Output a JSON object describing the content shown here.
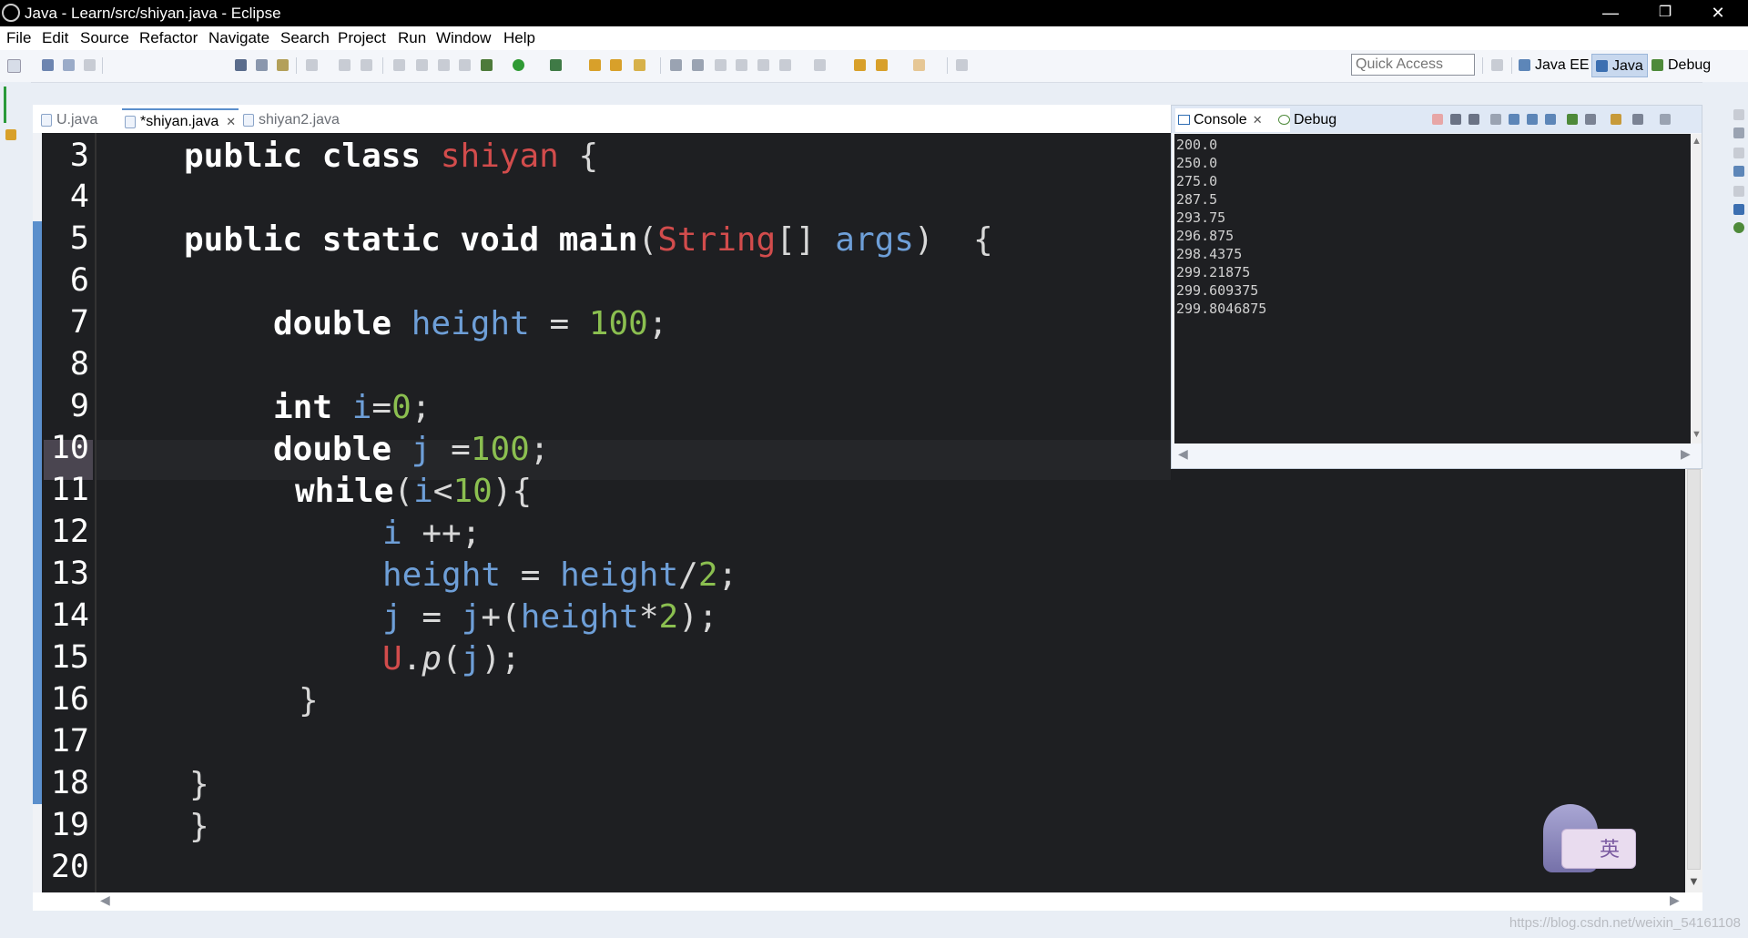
{
  "window": {
    "title": "Java - Learn/src/shiyan.java - Eclipse",
    "minimize": "—",
    "restore": "❐",
    "close": "✕"
  },
  "menu": [
    "File",
    "Edit",
    "Source",
    "Refactor",
    "Navigate",
    "Search",
    "Project",
    "Run",
    "Window",
    "Help"
  ],
  "toolbar": {
    "quick_access_placeholder": "Quick Access",
    "perspectives": [
      "Java EE",
      "Java",
      "Debug"
    ],
    "active_perspective": "Java"
  },
  "editor": {
    "tabs": [
      {
        "label": "U.java",
        "active": false,
        "close": ""
      },
      {
        "label": "*shiyan.java",
        "active": true,
        "close": "✕"
      },
      {
        "label": "shiyan2.java",
        "active": false,
        "close": ""
      }
    ],
    "current_line": "7",
    "line_numbers": [
      "3",
      "4",
      "5",
      "6",
      "7",
      "8",
      "9",
      "10",
      "11",
      "12",
      "13",
      "14",
      "15",
      "16",
      "17",
      "18",
      "19",
      "20"
    ],
    "code": {
      "l3": {
        "kw": "public class ",
        "cls": "shiyan",
        "rest": " {"
      },
      "l5": {
        "kw": "public static void main",
        "p1": "(",
        "cls": "String",
        "p2": "[] ",
        "var": "args",
        "p3": ")  {"
      },
      "l7": {
        "kw": "double ",
        "var": "height",
        "p1": " = ",
        "num": "100",
        "p2": ";"
      },
      "l9": {
        "kw": "int ",
        "var": "i",
        "p1": "=",
        "num": "0",
        "p2": ";"
      },
      "l10": {
        "kw": "double ",
        "var": "j",
        "p1": " =",
        "num": "100",
        "p2": ";"
      },
      "l11": {
        "kw": "while",
        "p1": "(",
        "var": "i",
        "p2": "<",
        "num": "10",
        "p3": "){"
      },
      "l12": {
        "var": "i",
        "p1": " ++;"
      },
      "l13": {
        "var1": "height",
        "p1": " = ",
        "var2": "height",
        "p2": "/",
        "num": "2",
        "p3": ";"
      },
      "l14": {
        "var1": "j",
        "p1": " = ",
        "var2": "j",
        "p2": "+(",
        "var3": "height",
        "p3": "*",
        "num": "2",
        "p4": ");"
      },
      "l15": {
        "cls": "U",
        "p1": ".",
        "ita": "p",
        "p2": "(",
        "var": "j",
        "p3": ");"
      },
      "l16": {
        "p1": "}"
      },
      "l18": {
        "p1": "}"
      },
      "l19": {
        "p1": "}"
      }
    }
  },
  "console": {
    "tabs": [
      {
        "label": "Console",
        "active": true,
        "close": "✕"
      },
      {
        "label": "Debug",
        "active": false,
        "close": ""
      }
    ],
    "lines": [
      "200.0",
      "250.0",
      "275.0",
      "287.5",
      "293.75",
      "296.875",
      "298.4375",
      "299.21875",
      "299.609375",
      "299.8046875"
    ]
  },
  "watermark": "https://blog.csdn.net/weixin_54161108",
  "sticker_text": "英"
}
